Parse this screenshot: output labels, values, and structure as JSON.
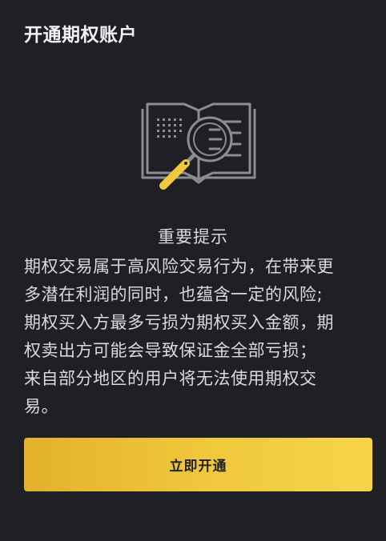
{
  "header": {
    "title": "开通期权账户"
  },
  "illustration": {
    "icon": "book-magnifier-icon",
    "accent_color": "#f0c93c",
    "line_color": "#8a8d93"
  },
  "notice": {
    "heading": "重要提示",
    "lines": [
      "期权交易属于高风险交易行为，在带来更",
      "多潜在利润的同时，也蕴含一定的风险;",
      "期权买入方最多亏损为期权买入金额，期",
      "权卖出方可能会导致保证金全部亏损；",
      "来自部分地区的用户将无法使用期权交",
      "易。"
    ]
  },
  "actions": {
    "open_label": "立即开通"
  },
  "colors": {
    "background": "#1f2025",
    "text": "#eaecef",
    "button_start": "#e3b12c",
    "button_end": "#f6d44a"
  }
}
